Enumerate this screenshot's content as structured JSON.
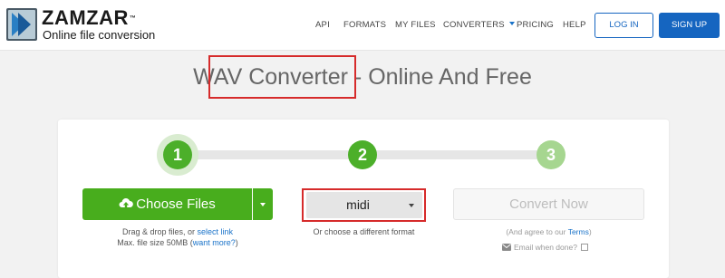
{
  "header": {
    "logo": {
      "name": "ZAMZAR",
      "trademark": "™",
      "tagline": "Online file conversion"
    },
    "nav": [
      {
        "label": "API"
      },
      {
        "label": "FORMATS"
      },
      {
        "label": "MY FILES"
      },
      {
        "label": "CONVERTERS",
        "has_dropdown": true
      },
      {
        "label": "PRICING"
      },
      {
        "label": "HELP"
      }
    ],
    "login_label": "LOG IN",
    "signup_label": "SIGN UP"
  },
  "title": {
    "highlight": "WAV Converter",
    "rest": " - Online And Free"
  },
  "steps": [
    "1",
    "2",
    "3"
  ],
  "step1": {
    "choose_label": "Choose Files",
    "drag_text": "Drag & drop files, or ",
    "select_link": "select link",
    "max_size_text": "Max. file size 50MB (",
    "want_more_link": "want more?",
    "max_size_close": ")"
  },
  "step2": {
    "format_value": "midi",
    "help_text": "Or choose a different format"
  },
  "step3": {
    "convert_label": "Convert Now",
    "agree_prefix": "(And agree to our ",
    "terms_link": "Terms",
    "agree_suffix": ")",
    "email_label": "Email when done?"
  },
  "colors": {
    "brand_blue": "#1565c0",
    "green": "#48ad1d",
    "highlight_red": "#d62b2b"
  },
  "icons": {
    "upload": "cloud-upload-icon",
    "email": "envelope-icon",
    "caret": "caret-down-icon"
  }
}
